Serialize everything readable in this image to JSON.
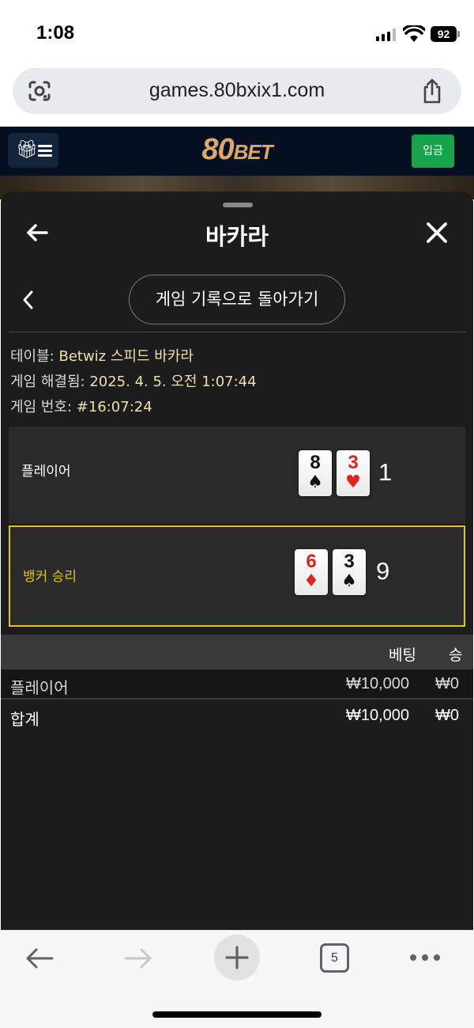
{
  "status_bar": {
    "time": "1:08",
    "battery": "92"
  },
  "browser": {
    "url": "games.80bxix1.com",
    "tab_count": "5"
  },
  "site": {
    "logo_num": "80",
    "logo_text": "BET",
    "deposit_label": "입금"
  },
  "modal": {
    "title": "바카라",
    "return_button": "게임 기록으로 돌아가기",
    "info": [
      {
        "label": "테이블: ",
        "value": "Betwiz 스피드 바카라"
      },
      {
        "label": "게임 해결됨: ",
        "value": "2025. 4. 5. 오전 1:07:44"
      },
      {
        "label": "게임 번호: ",
        "value": "#16:07:24"
      }
    ],
    "player": {
      "label": "플레이어",
      "cards": [
        {
          "rank": "8",
          "suit": "♠"
        },
        {
          "rank": "3",
          "suit": "♥"
        }
      ],
      "score": "1"
    },
    "banker": {
      "label": "뱅커 승리",
      "cards": [
        {
          "rank": "6",
          "suit": "♦"
        },
        {
          "rank": "3",
          "suit": "♠"
        }
      ],
      "score": "9"
    },
    "bets_table": {
      "headers": {
        "bet": "베팅",
        "win": "승"
      },
      "rows": [
        {
          "name": "플레이어",
          "bet": "₩10,000",
          "win": "₩0"
        }
      ],
      "total": {
        "name": "합계",
        "bet": "₩10,000",
        "win": "₩0"
      }
    }
  },
  "colors": {
    "accent_gold": "#e1c21e",
    "modal_bg": "#1c1c1c",
    "deposit_green": "#17a34a",
    "card_red": "#e0231c"
  }
}
